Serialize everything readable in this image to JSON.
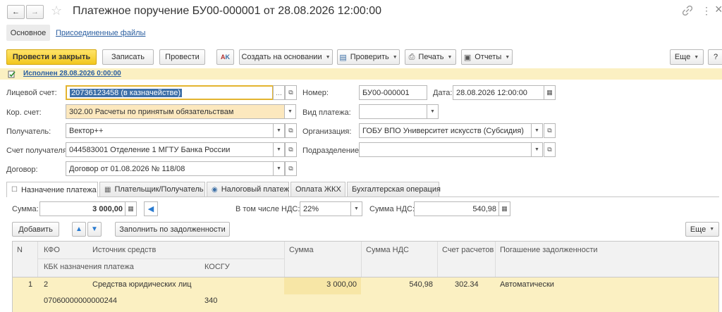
{
  "window": {
    "title": "Платежное поручение БУ00-000001 от 28.08.2026 12:00:00",
    "nav_back": "←",
    "nav_forward": "→",
    "star": "☆",
    "link_icon": "link-icon",
    "more_icon": "⋮",
    "close_icon": "×"
  },
  "subtabs": {
    "main": "Основное",
    "files": "Присоединенные файлы"
  },
  "toolbar": {
    "post_close": "Провести и закрыть",
    "save": "Записать",
    "post": "Провести",
    "create_based": "Создать на основании",
    "check": "Проверить",
    "print": "Печать",
    "reports": "Отчеты",
    "more": "Еще",
    "help": "?"
  },
  "status": {
    "text": "Исполнен 28.08.2026 0:00:00"
  },
  "form": {
    "personal_account_label": "Лицевой счет:",
    "personal_account_value": "20736123458 (в казначействе)",
    "corr_account_label": "Кор. счет:",
    "corr_account_value": "302.00 Расчеты по принятым обязательствам",
    "recipient_label": "Получатель:",
    "recipient_value": "Вектор++",
    "recipient_account_label": "Счет получателя:",
    "recipient_account_value": "044583001 Отделение 1 МГТУ Банка России",
    "contract_label": "Договор:",
    "contract_value": "Договор от 01.08.2026 № 118/08",
    "number_label": "Номер:",
    "number_value": "БУ00-000001",
    "date_label": "Дата:",
    "date_value": "28.08.2026 12:00:00",
    "payment_type_label": "Вид платежа:",
    "payment_type_value": "",
    "organization_label": "Организация:",
    "organization_value": "ГОБУ ВПО Университет искусств (Субсидия)",
    "department_label": "Подразделение:",
    "department_value": ""
  },
  "tabs": [
    {
      "label": "Назначение платежа",
      "icon": "☐"
    },
    {
      "label": "Плательщик/Получатель",
      "icon": "▦"
    },
    {
      "label": "Налоговый платеж",
      "icon": "◉"
    },
    {
      "label": "Оплата ЖКХ",
      "icon": ""
    },
    {
      "label": "Бухгалтерская операция",
      "icon": ""
    }
  ],
  "payment": {
    "sum_label": "Сумма:",
    "sum_value": "3 000,00",
    "vat_included_label": "В том числе НДС:",
    "vat_rate": "22%",
    "vat_sum_label": "Сумма НДС:",
    "vat_sum_value": "540,98"
  },
  "table_toolbar": {
    "add": "Добавить",
    "fill": "Заполнить по задолженности",
    "more": "Еще"
  },
  "table": {
    "headers": {
      "n": "N",
      "kfo": "КФО",
      "source": "Источник средств",
      "sum": "Сумма",
      "vat_sum": "Сумма НДС",
      "account": "Счет расчетов",
      "debt": "Погашение задолженности",
      "kbk": "КБК назначения платежа",
      "kosgu": "КОСГУ"
    },
    "rows": [
      {
        "n": "1",
        "kfo": "2",
        "source": "Средства юридических лиц",
        "sum": "3 000,00",
        "vat_sum": "540,98",
        "account": "302.34",
        "debt": "Автоматически",
        "kbk": "07060000000000244",
        "kosgu": "340"
      }
    ]
  },
  "colors": {
    "accent_yellow": "#f2c71d",
    "selected_row": "#fbf0c2",
    "field_highlight": "#fce8be"
  }
}
